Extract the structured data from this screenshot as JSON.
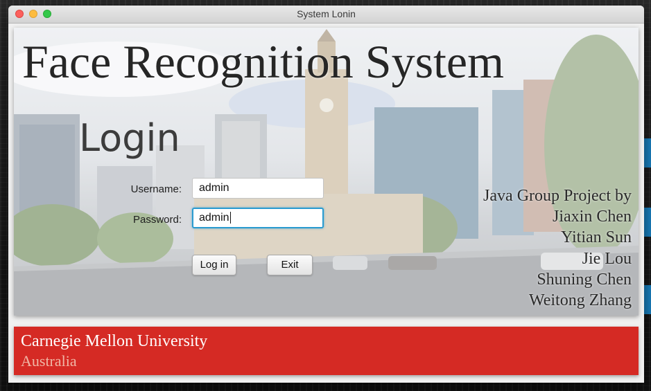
{
  "window": {
    "title": "System Lonin"
  },
  "banner": {
    "app_title": "Face Recognition System",
    "login_heading": "Login"
  },
  "form": {
    "username_label": "Username:",
    "username_value": "admin",
    "password_label": "Password:",
    "password_value": "admin",
    "login_button": "Log in",
    "exit_button": "Exit"
  },
  "credits": {
    "heading": "Java Group Project by",
    "members": [
      "Jiaxin Chen",
      "Yitian Sun",
      "Jie Lou",
      "Shuning Chen",
      "Weitong Zhang"
    ]
  },
  "footer": {
    "university": "Carnegie Mellon University",
    "campus": "Australia"
  },
  "colors": {
    "footer_red": "#d52a24",
    "focus_blue": "#2a9bd0"
  },
  "icons": [
    "close-window-icon",
    "minimize-window-icon",
    "zoom-window-icon"
  ]
}
